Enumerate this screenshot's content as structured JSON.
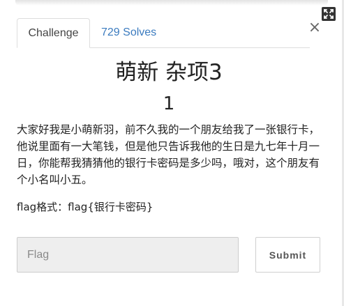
{
  "modal": {
    "tabs": [
      {
        "label": "Challenge",
        "active": true
      },
      {
        "label": "729 Solves",
        "active": false
      }
    ],
    "close_symbol": "×",
    "challenge": {
      "name": "萌新 杂项3",
      "points": "1",
      "description": "大家好我是小萌新羽，前不久我的一个朋友给我了一张银行卡，他说里面有一大笔钱，但是他只告诉我他的生日是九七年十月一日，你能帮我猜猜他的银行卡密码是多少吗，哦对，这个朋友有个小名叫小五。",
      "flag_format": "flag格式：flag{银行卡密码}"
    },
    "flag_input": {
      "placeholder": "Flag",
      "value": ""
    },
    "submit_label": "Submit"
  },
  "icons": {
    "expand": "expand-icon",
    "close": "close-icon"
  },
  "colors": {
    "tab_link": "#3b7bbf",
    "input_bg": "#eeeeee",
    "text": "#222222"
  }
}
